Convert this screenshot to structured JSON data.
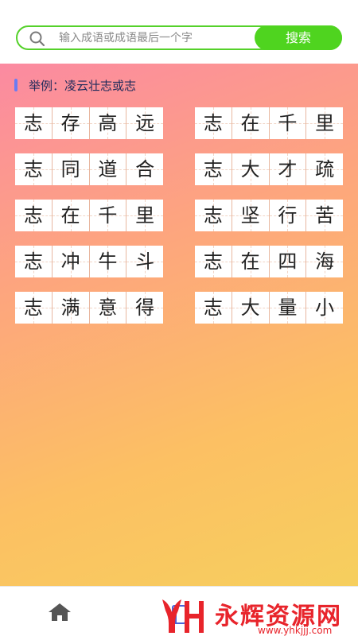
{
  "search": {
    "placeholder": "输入成语或成语最后一个字",
    "button_label": "搜索",
    "icon": "search-icon"
  },
  "example": {
    "text": "举例：凌云壮志或志"
  },
  "idioms": [
    [
      "志",
      "存",
      "高",
      "远"
    ],
    [
      "志",
      "在",
      "千",
      "里"
    ],
    [
      "志",
      "同",
      "道",
      "合"
    ],
    [
      "志",
      "大",
      "才",
      "疏"
    ],
    [
      "志",
      "在",
      "千",
      "里"
    ],
    [
      "志",
      "坚",
      "行",
      "苦"
    ],
    [
      "志",
      "冲",
      "牛",
      "斗"
    ],
    [
      "志",
      "在",
      "四",
      "海"
    ],
    [
      "志",
      "满",
      "意",
      "得"
    ],
    [
      "志",
      "大",
      "量",
      "小"
    ]
  ],
  "bottom_nav": {
    "home_icon": "home-icon"
  },
  "watermark": {
    "title": "永辉资源网",
    "url": "www.yhkjjj.com"
  },
  "colors": {
    "accent_green": "#4fd41f",
    "gradient_top": "#fb8aa1",
    "gradient_bottom": "#f6cf5e",
    "watermark_red": "#e8242b"
  }
}
